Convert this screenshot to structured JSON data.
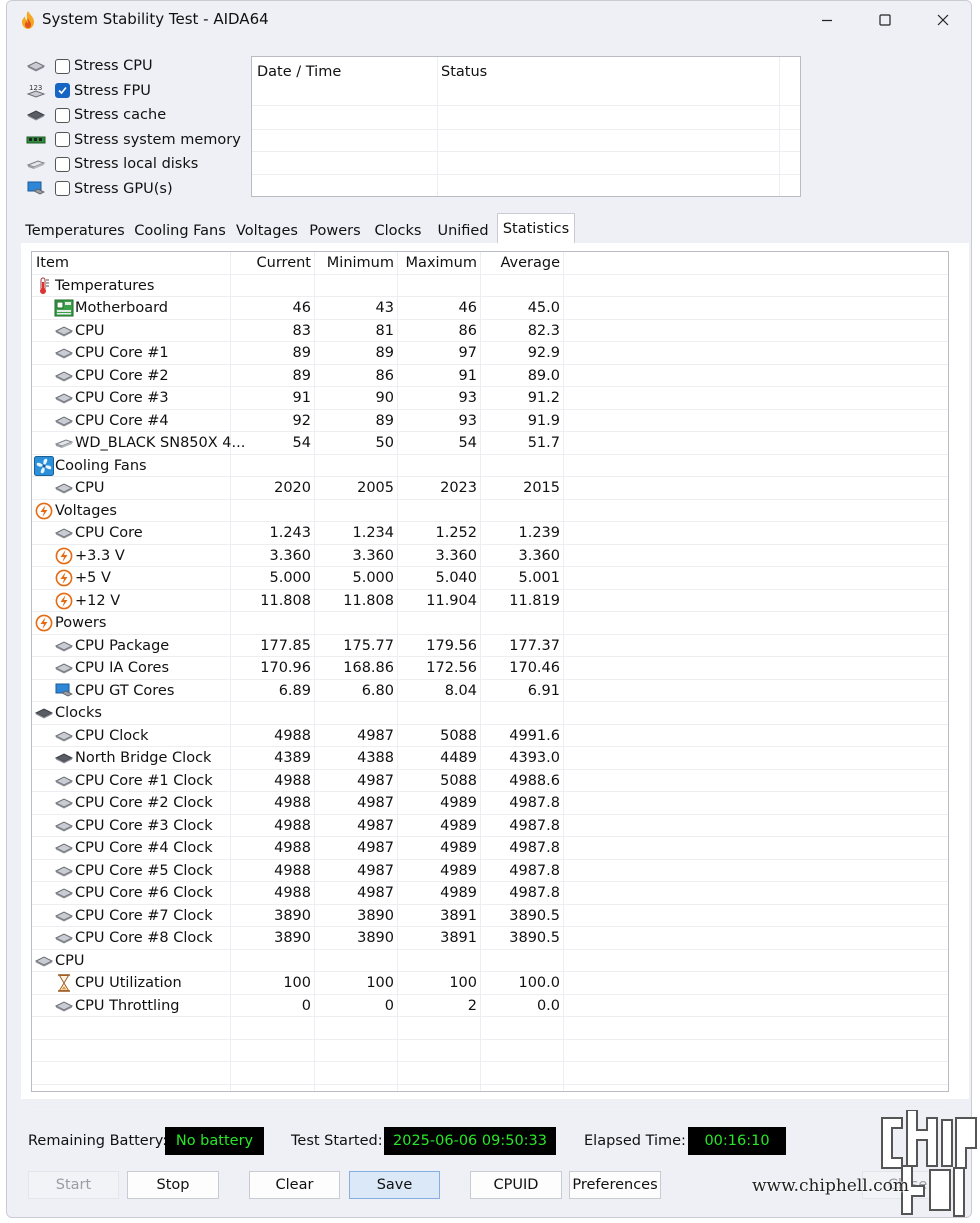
{
  "window": {
    "title": "System Stability Test - AIDA64"
  },
  "stress": [
    {
      "label": "Stress CPU",
      "checked": false,
      "icon": "cpu-chip-icon"
    },
    {
      "label": "Stress FPU",
      "checked": true,
      "icon": "fpu-123-icon"
    },
    {
      "label": "Stress cache",
      "checked": false,
      "icon": "cache-chip-icon"
    },
    {
      "label": "Stress system memory",
      "checked": false,
      "icon": "memory-module-icon"
    },
    {
      "label": "Stress local disks",
      "checked": false,
      "icon": "disk-drive-icon"
    },
    {
      "label": "Stress GPU(s)",
      "checked": false,
      "icon": "gpu-monitor-icon"
    }
  ],
  "log": {
    "col_datetime": "Date / Time",
    "col_status": "Status"
  },
  "tabs": [
    {
      "label": "Temperatures"
    },
    {
      "label": "Cooling Fans"
    },
    {
      "label": "Voltages"
    },
    {
      "label": "Powers"
    },
    {
      "label": "Clocks"
    },
    {
      "label": "Unified"
    },
    {
      "label": "Statistics",
      "active": true
    }
  ],
  "stats": {
    "headers": {
      "item": "Item",
      "current": "Current",
      "minimum": "Minimum",
      "maximum": "Maximum",
      "average": "Average"
    },
    "rows": [
      {
        "item": "Temperatures",
        "group": true,
        "icon": "thermometer-icon"
      },
      {
        "item": "Motherboard",
        "icon": "motherboard-icon",
        "current": "46",
        "minimum": "43",
        "maximum": "46",
        "average": "45.0"
      },
      {
        "item": "CPU",
        "icon": "cpu-chip-icon",
        "current": "83",
        "minimum": "81",
        "maximum": "86",
        "average": "82.3"
      },
      {
        "item": "CPU Core #1",
        "icon": "cpu-chip-icon",
        "current": "89",
        "minimum": "89",
        "maximum": "97",
        "average": "92.9"
      },
      {
        "item": "CPU Core #2",
        "icon": "cpu-chip-icon",
        "current": "89",
        "minimum": "86",
        "maximum": "91",
        "average": "89.0"
      },
      {
        "item": "CPU Core #3",
        "icon": "cpu-chip-icon",
        "current": "91",
        "minimum": "90",
        "maximum": "93",
        "average": "91.2"
      },
      {
        "item": "CPU Core #4",
        "icon": "cpu-chip-icon",
        "current": "92",
        "minimum": "89",
        "maximum": "93",
        "average": "91.9"
      },
      {
        "item": "WD_BLACK SN850X 4...",
        "icon": "disk-drive-icon",
        "current": "54",
        "minimum": "50",
        "maximum": "54",
        "average": "51.7"
      },
      {
        "item": "Cooling Fans",
        "group": true,
        "icon": "fan-icon"
      },
      {
        "item": "CPU",
        "icon": "cpu-chip-icon",
        "current": "2020",
        "minimum": "2005",
        "maximum": "2023",
        "average": "2015"
      },
      {
        "item": "Voltages",
        "group": true,
        "icon": "lightning-icon"
      },
      {
        "item": "CPU Core",
        "icon": "cpu-chip-icon",
        "current": "1.243",
        "minimum": "1.234",
        "maximum": "1.252",
        "average": "1.239"
      },
      {
        "item": "+3.3 V",
        "icon": "lightning-icon",
        "current": "3.360",
        "minimum": "3.360",
        "maximum": "3.360",
        "average": "3.360"
      },
      {
        "item": "+5 V",
        "icon": "lightning-icon",
        "current": "5.000",
        "minimum": "5.000",
        "maximum": "5.040",
        "average": "5.001"
      },
      {
        "item": "+12 V",
        "icon": "lightning-icon",
        "current": "11.808",
        "minimum": "11.808",
        "maximum": "11.904",
        "average": "11.819"
      },
      {
        "item": "Powers",
        "group": true,
        "icon": "lightning-icon"
      },
      {
        "item": "CPU Package",
        "icon": "cpu-chip-icon",
        "current": "177.85",
        "minimum": "175.77",
        "maximum": "179.56",
        "average": "177.37"
      },
      {
        "item": "CPU IA Cores",
        "icon": "cpu-chip-icon",
        "current": "170.96",
        "minimum": "168.86",
        "maximum": "172.56",
        "average": "170.46"
      },
      {
        "item": "CPU GT Cores",
        "icon": "gpu-monitor-icon",
        "current": "6.89",
        "minimum": "6.80",
        "maximum": "8.04",
        "average": "6.91"
      },
      {
        "item": "Clocks",
        "group": true,
        "icon": "cache-chip-icon"
      },
      {
        "item": "CPU Clock",
        "icon": "cpu-chip-icon",
        "current": "4988",
        "minimum": "4987",
        "maximum": "5088",
        "average": "4991.6"
      },
      {
        "item": "North Bridge Clock",
        "icon": "cache-chip-icon",
        "current": "4389",
        "minimum": "4388",
        "maximum": "4489",
        "average": "4393.0"
      },
      {
        "item": "CPU Core #1 Clock",
        "icon": "cpu-chip-icon",
        "current": "4988",
        "minimum": "4987",
        "maximum": "5088",
        "average": "4988.6"
      },
      {
        "item": "CPU Core #2 Clock",
        "icon": "cpu-chip-icon",
        "current": "4988",
        "minimum": "4987",
        "maximum": "4989",
        "average": "4987.8"
      },
      {
        "item": "CPU Core #3 Clock",
        "icon": "cpu-chip-icon",
        "current": "4988",
        "minimum": "4987",
        "maximum": "4989",
        "average": "4987.8"
      },
      {
        "item": "CPU Core #4 Clock",
        "icon": "cpu-chip-icon",
        "current": "4988",
        "minimum": "4987",
        "maximum": "4989",
        "average": "4987.8"
      },
      {
        "item": "CPU Core #5 Clock",
        "icon": "cpu-chip-icon",
        "current": "4988",
        "minimum": "4987",
        "maximum": "4989",
        "average": "4987.8"
      },
      {
        "item": "CPU Core #6 Clock",
        "icon": "cpu-chip-icon",
        "current": "4988",
        "minimum": "4987",
        "maximum": "4989",
        "average": "4987.8"
      },
      {
        "item": "CPU Core #7 Clock",
        "icon": "cpu-chip-icon",
        "current": "3890",
        "minimum": "3890",
        "maximum": "3891",
        "average": "3890.5"
      },
      {
        "item": "CPU Core #8 Clock",
        "icon": "cpu-chip-icon",
        "current": "3890",
        "minimum": "3890",
        "maximum": "3891",
        "average": "3890.5"
      },
      {
        "item": "CPU",
        "group": true,
        "icon": "cpu-chip-icon"
      },
      {
        "item": "CPU Utilization",
        "icon": "hourglass-icon",
        "current": "100",
        "minimum": "100",
        "maximum": "100",
        "average": "100.0"
      },
      {
        "item": "CPU Throttling",
        "icon": "cpu-chip-icon",
        "current": "0",
        "minimum": "0",
        "maximum": "2",
        "average": "0.0"
      }
    ]
  },
  "status": {
    "battery_label": "Remaining Battery:",
    "battery_value": "No battery",
    "started_label": "Test Started:",
    "started_value": "2025-06-06 09:50:33",
    "elapsed_label": "Elapsed Time:",
    "elapsed_value": "00:16:10"
  },
  "buttons": {
    "start": "Start",
    "stop": "Stop",
    "clear": "Clear",
    "save": "Save",
    "cpuid": "CPUID",
    "preferences": "Preferences",
    "close": "Close"
  },
  "watermark": {
    "site": "www.chiphell.com"
  },
  "colors": {
    "lcd_text": "#28e628",
    "accent": "#1664c4",
    "window_bg": "#eef0f5"
  }
}
